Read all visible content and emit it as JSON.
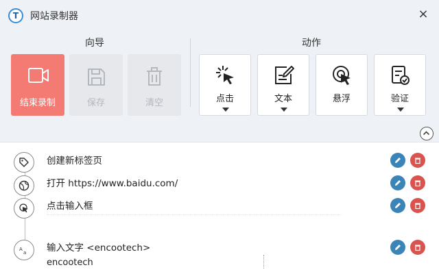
{
  "window": {
    "title": "网站录制器",
    "logo_letter": "T",
    "close_symbol": "×"
  },
  "wizard": {
    "title": "向导",
    "stop_label": "结束录制",
    "save_label": "保存",
    "clear_label": "清空"
  },
  "actions": {
    "title": "动作",
    "click_label": "点击",
    "text_label": "文本",
    "hover_label": "悬浮",
    "verify_label": "验证"
  },
  "steps": [
    {
      "label": "创建新标签页",
      "icon": "tag-icon"
    },
    {
      "label": "打开 https://www.baidu.com/",
      "icon": "globe-icon"
    },
    {
      "label": "点击输入框",
      "icon": "cursor-click-icon"
    },
    {
      "label": "输入文字 <encootech>",
      "detail": "encootech",
      "icon": "text-input-icon"
    }
  ],
  "colors": {
    "stop_button": "#f47b73",
    "edit_button": "#3b84b8",
    "delete_button": "#d9534f",
    "toolbar_bg": "#eef1f6"
  }
}
